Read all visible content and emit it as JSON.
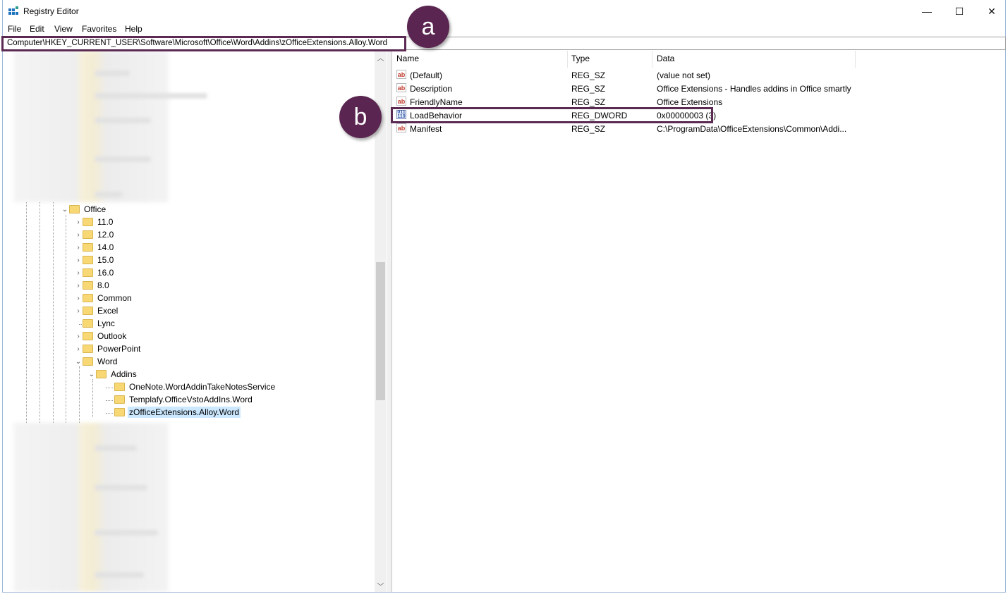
{
  "window": {
    "title": "Registry Editor",
    "minimize": "—",
    "maximize": "☐",
    "close": "✕"
  },
  "menu": [
    "File",
    "Edit",
    "View",
    "Favorites",
    "Help"
  ],
  "address": "Computer\\HKEY_CURRENT_USER\\Software\\Microsoft\\Office\\Word\\Addins\\zOfficeExtensions.Alloy.Word",
  "annotations": {
    "a": "a",
    "b": "b"
  },
  "tree": {
    "office": "Office",
    "children": [
      "11.0",
      "12.0",
      "14.0",
      "15.0",
      "16.0",
      "8.0",
      "Common",
      "Excel",
      "Lync",
      "Outlook",
      "PowerPoint",
      "Word"
    ],
    "addins": "Addins",
    "addin_items": [
      "OneNote.WordAddinTakeNotesService",
      "Templafy.OfficeVstoAddIns.Word",
      "zOfficeExtensions.Alloy.Word"
    ]
  },
  "list": {
    "columns": [
      "Name",
      "Type",
      "Data"
    ],
    "rows": [
      {
        "name": "(Default)",
        "type": "REG_SZ",
        "data": "(value not set)",
        "icon": "string-value-icon"
      },
      {
        "name": "Description",
        "type": "REG_SZ",
        "data": "Office Extensions - Handles addins in Office smartly",
        "icon": "string-value-icon"
      },
      {
        "name": "FriendlyName",
        "type": "REG_SZ",
        "data": "Office Extensions",
        "icon": "string-value-icon"
      },
      {
        "name": "LoadBehavior",
        "type": "REG_DWORD",
        "data": "0x00000003 (3)",
        "icon": "dword-value-icon"
      },
      {
        "name": "Manifest",
        "type": "REG_SZ",
        "data": "C:\\ProgramData\\OfficeExtensions\\Common\\Addi...",
        "icon": "string-value-icon"
      }
    ]
  },
  "colors": {
    "highlight_border": "#5a2a52",
    "badge": "#5a2550",
    "selection": "#cce8ff",
    "folder": "#f8d775"
  }
}
